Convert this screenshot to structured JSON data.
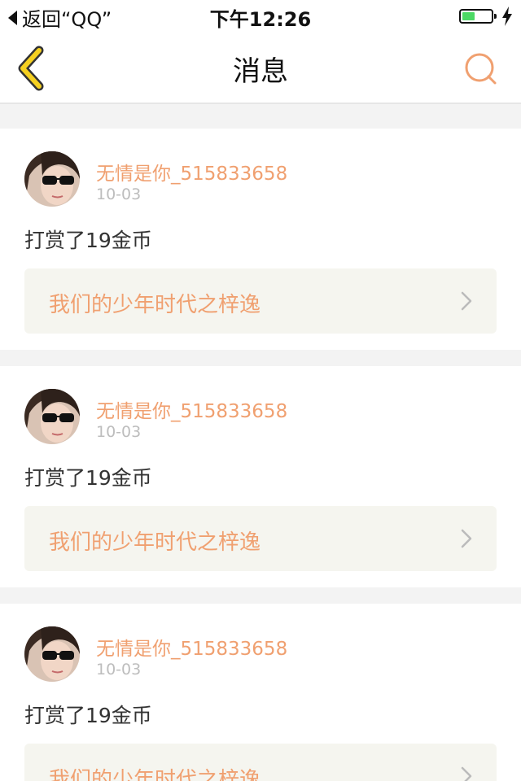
{
  "status_bar": {
    "back_label": "返回“QQ”",
    "time": "下午12:26",
    "battery_level": 0.45
  },
  "nav": {
    "title": "消息"
  },
  "messages": [
    {
      "user": "无情是你_515833658",
      "date": "10-03",
      "action": "打赏了19金币",
      "book": "我们的少年时代之梓逸"
    },
    {
      "user": "无情是你_515833658",
      "date": "10-03",
      "action": "打赏了19金币",
      "book": "我们的少年时代之梓逸"
    },
    {
      "user": "无情是你_515833658",
      "date": "10-03",
      "action": "打赏了19金币",
      "book": "我们的少年时代之梓逸"
    }
  ],
  "colors": {
    "accent": "#f0a070",
    "back_arrow": "#f5d020",
    "battery": "#4cd964",
    "card_bg": "#ffffff",
    "link_bg": "#f5f5ef",
    "page_bg": "#f3f3f3"
  },
  "icons": {
    "back": "chevron-left-icon",
    "search": "search-icon",
    "disclosure": "chevron-right-icon"
  }
}
